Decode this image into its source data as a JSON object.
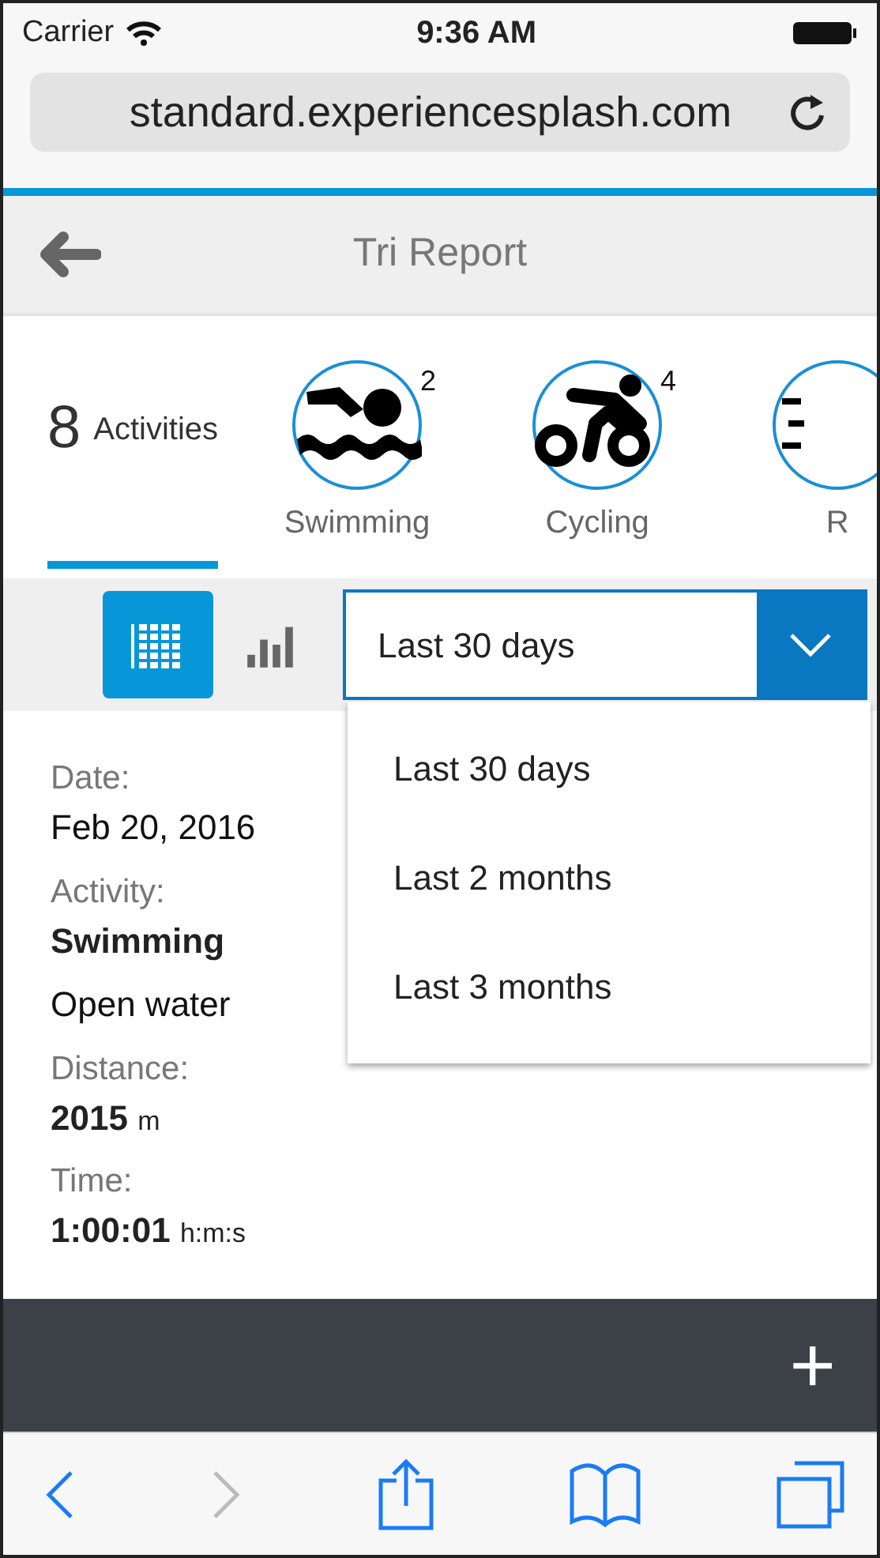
{
  "status_bar": {
    "carrier": "Carrier",
    "time": "9:36 AM"
  },
  "browser": {
    "url": "standard.experiencesplash.com"
  },
  "header": {
    "title": "Tri Report"
  },
  "activity_tabs": [
    {
      "kind": "summary",
      "count": "8",
      "label": "Activities",
      "selected": true
    },
    {
      "kind": "swimming",
      "label": "Swimming",
      "badge": "2",
      "selected": false
    },
    {
      "kind": "cycling",
      "label": "Cycling",
      "badge": "4",
      "selected": false
    },
    {
      "kind": "running",
      "label": "R",
      "selected": false
    }
  ],
  "view_toggle": [
    {
      "kind": "calendar",
      "selected": true
    },
    {
      "kind": "chart",
      "selected": false
    }
  ],
  "period_select": {
    "value": "Last 30 days",
    "expanded": true,
    "options": [
      "Last 30 days",
      "Last 2 months",
      "Last 3 months"
    ]
  },
  "details": [
    {
      "kind": "label",
      "text": "Date:"
    },
    {
      "kind": "value",
      "text": "Feb 20, 2016"
    },
    {
      "kind": "label",
      "text": "Activity:"
    },
    {
      "kind": "strong",
      "text": "Swimming"
    },
    {
      "kind": "value",
      "text": "Open water"
    },
    {
      "kind": "label",
      "text": "Distance:"
    },
    {
      "kind": "strong",
      "text": "2015",
      "unit": "m"
    },
    {
      "kind": "label",
      "text": "Time:"
    },
    {
      "kind": "strong",
      "text": "1:00:01",
      "unit": "h:m:s"
    }
  ],
  "footer": {
    "add_symbol": "+"
  },
  "browser_toolbar": {
    "back_disabled": false,
    "forward_disabled": true
  }
}
